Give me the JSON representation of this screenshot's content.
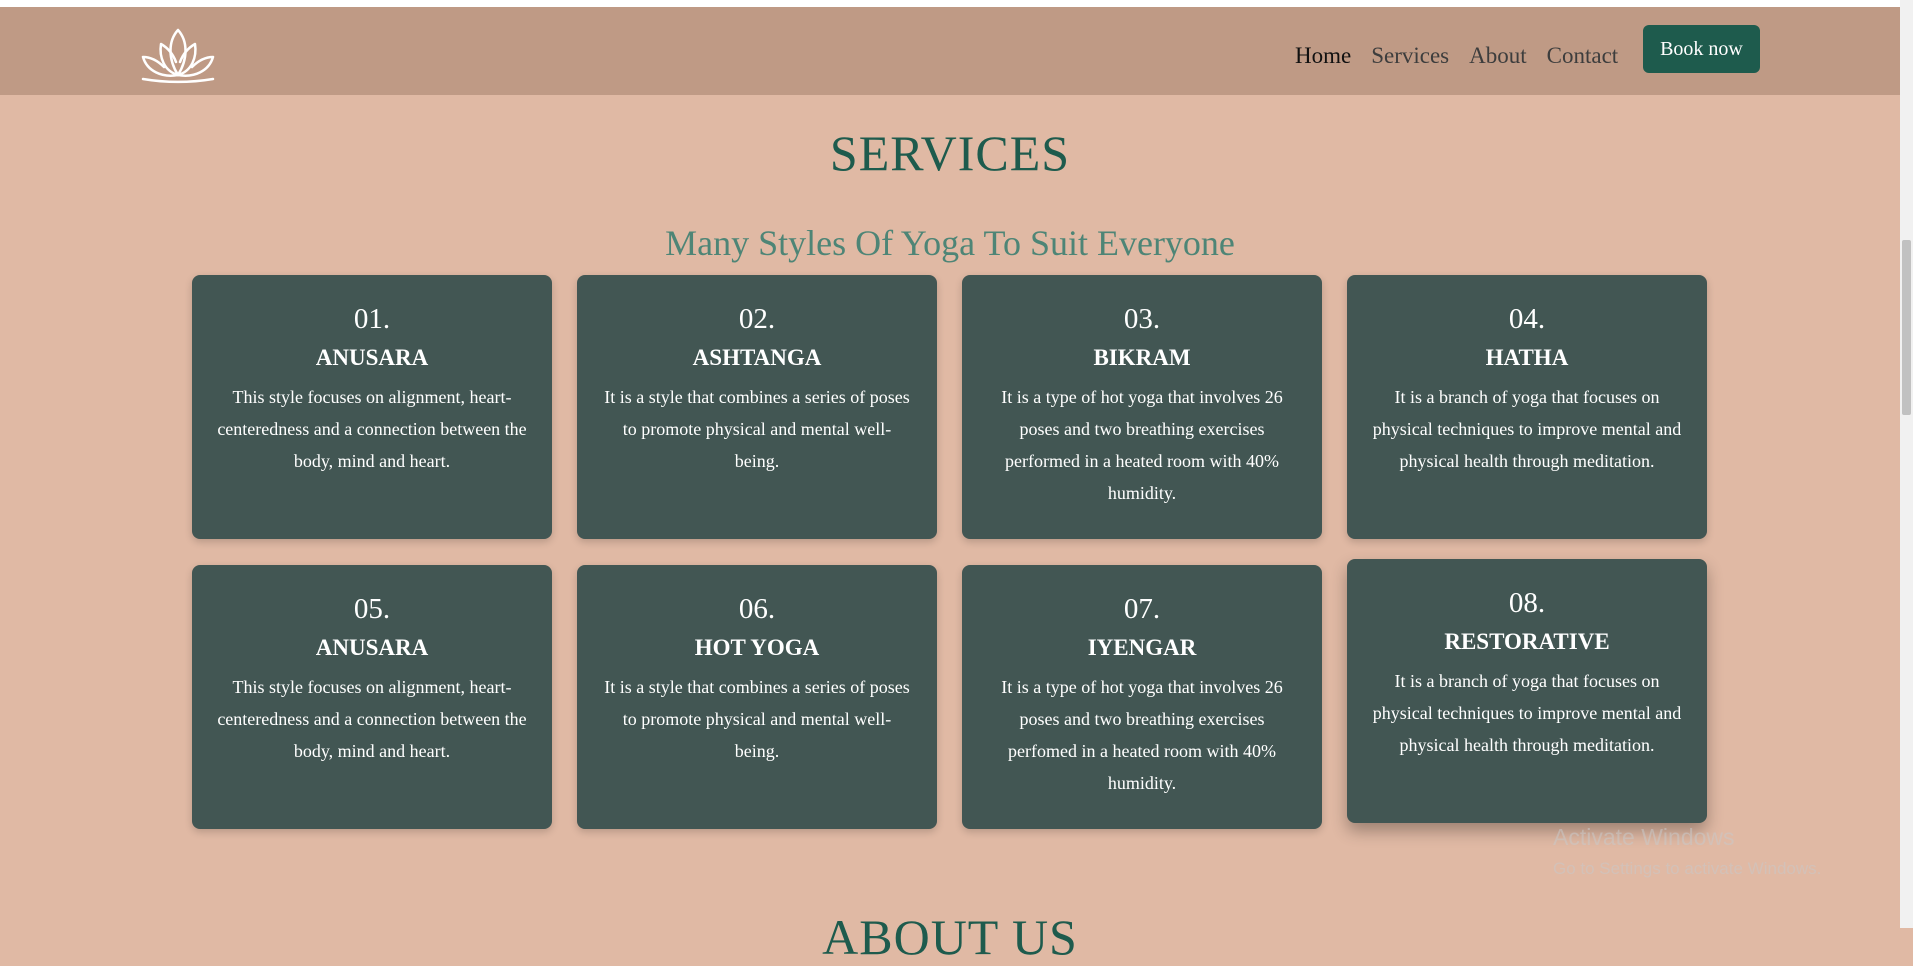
{
  "nav": {
    "logo_icon": "lotus-icon",
    "links": [
      {
        "label": "Home",
        "active": true
      },
      {
        "label": "Services",
        "active": false
      },
      {
        "label": "About",
        "active": false
      },
      {
        "label": "Contact",
        "active": false
      }
    ],
    "book_label": "Book now"
  },
  "services": {
    "title": "SERVICES",
    "subtitle": "Many Styles Of Yoga To Suit Everyone",
    "cards": [
      {
        "num": "01.",
        "name": "ANUSARA",
        "desc": "This style focuses on alignment, heart-centeredness and a connection between the body, mind and heart."
      },
      {
        "num": "02.",
        "name": "ASHTANGA",
        "desc": "It is a style that combines a series of poses to promote physical and mental well-being."
      },
      {
        "num": "03.",
        "name": "BIKRAM",
        "desc": "It is a type of hot yoga that involves 26 poses and two breathing exercises performed in a heated room with 40% humidity."
      },
      {
        "num": "04.",
        "name": "HATHA",
        "desc": "It is a branch of yoga that focuses on physical techniques to improve mental and physical health through meditation."
      },
      {
        "num": "05.",
        "name": "ANUSARA",
        "desc": "This style focuses on alignment, heart-centeredness and a connection between the body, mind and heart."
      },
      {
        "num": "06.",
        "name": "HOT YOGA",
        "desc": "It is a style that combines a series of poses to promote physical and mental well-being."
      },
      {
        "num": "07.",
        "name": "IYENGAR",
        "desc": "It is a type of hot yoga that involves 26 poses and two breathing exercises perfomed in a heated room with 40% humidity."
      },
      {
        "num": "08.",
        "name": "RESTORATIVE",
        "desc": "It is a branch of yoga that focuses on physical techniques to improve mental and physical health through meditation."
      }
    ]
  },
  "watermark": {
    "line1": "Activate Windows",
    "line2": "Go to Settings to activate Windows."
  },
  "next_section_title": "ABOUT US",
  "colors": {
    "page_bg": "#e0b9a4",
    "nav_bg": "#bf9a85",
    "accent": "#1e5b4d",
    "card_bg": "#425653"
  }
}
